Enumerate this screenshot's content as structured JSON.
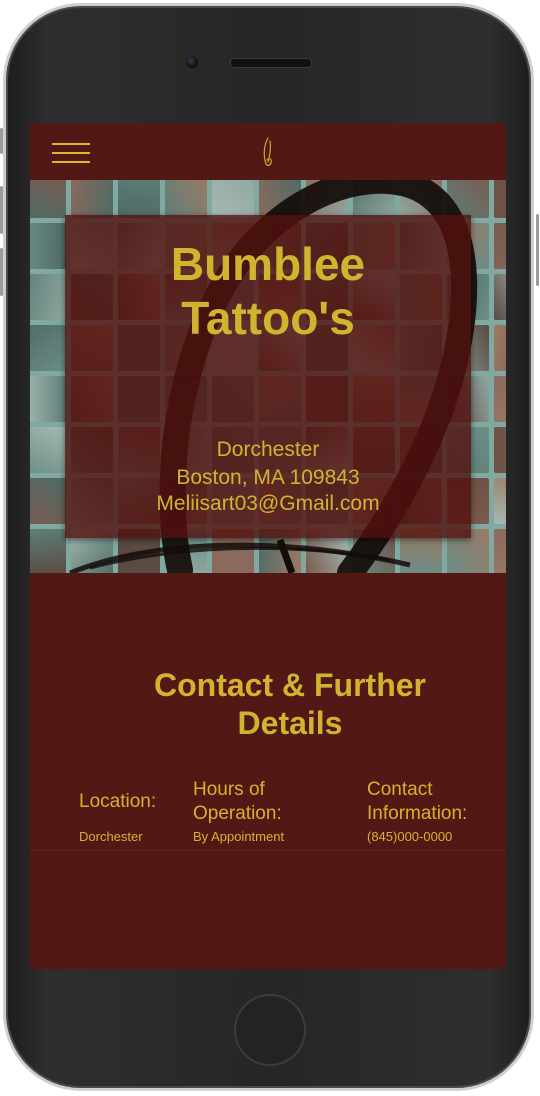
{
  "header": {
    "menu_icon": "hamburger-icon",
    "logo_icon": "signature-logo-icon"
  },
  "hero": {
    "title_line1": "Bumblee",
    "title_line2": "Tattoo's",
    "neighborhood": "Dorchester",
    "city_line": "Boston, MA 109843",
    "email": "Meliisart03@Gmail.com"
  },
  "contact_section": {
    "title_line1": "Contact & Further",
    "title_line2": "Details",
    "columns": [
      {
        "heading_line1": "Location:",
        "heading_line2": "",
        "value": "Dorchester"
      },
      {
        "heading_line1": "Hours of",
        "heading_line2": "Operation:",
        "value": "By Appointment"
      },
      {
        "heading_line1": "Contact",
        "heading_line2": "Information:",
        "value": "(845)000-0000"
      }
    ]
  },
  "colors": {
    "background": "#521816",
    "accent": "#cfb52f",
    "overlay": "#52100e"
  }
}
